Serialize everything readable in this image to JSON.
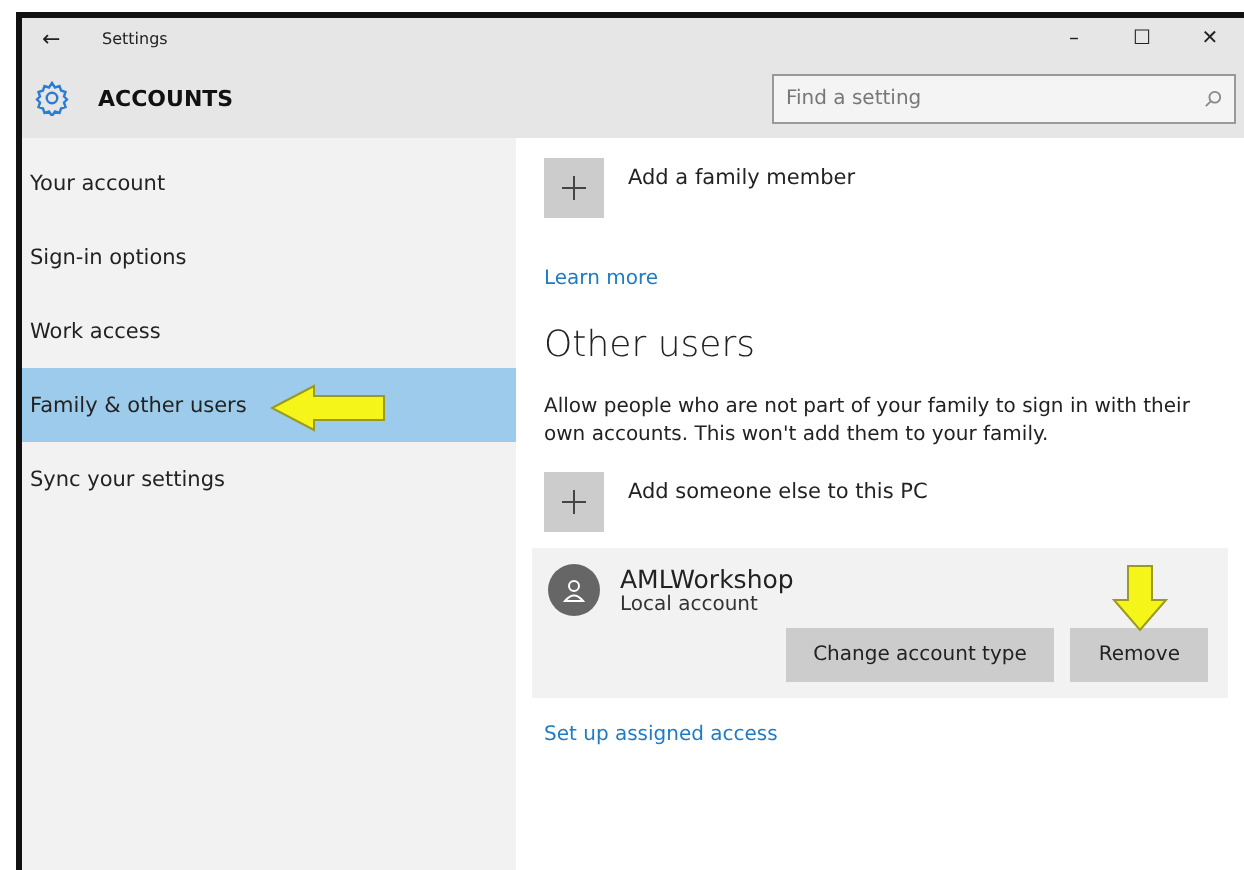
{
  "window": {
    "title": "Settings",
    "back": "←",
    "controls": [
      "–",
      "☐",
      "✕"
    ]
  },
  "header": {
    "title": "ACCOUNTS",
    "search": {
      "placeholder": "Find a setting"
    }
  },
  "sidebar": {
    "items": [
      {
        "label": "Your account",
        "selected": false,
        "callout": false
      },
      {
        "label": "Sign-in options",
        "selected": false,
        "callout": false
      },
      {
        "label": "Work access",
        "selected": false,
        "callout": false
      },
      {
        "label": "Family & other users",
        "selected": true,
        "callout": true
      },
      {
        "label": "Sync your settings",
        "selected": false,
        "callout": false
      }
    ]
  },
  "content": {
    "add_family": "Add a family member",
    "learn_more": "Learn more",
    "heading": "Other users",
    "description": "Allow people who are not part of your family to sign in with their own accounts. This won't add them to your family.",
    "add_other": "Add someone else to this PC",
    "user": {
      "name": "AMLWorkshop",
      "subtitle": "Local account",
      "buttons": [
        {
          "label": "Change account type",
          "callout": false
        },
        {
          "label": "Remove",
          "callout": true
        }
      ]
    },
    "assigned_access": "Set up assigned access"
  }
}
